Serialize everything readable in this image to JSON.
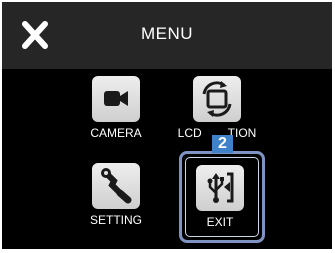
{
  "header": {
    "title": "MENU",
    "close_icon": "close-icon"
  },
  "menu": {
    "camera_label": "CAMERA",
    "lcd_label_left": "LCD",
    "lcd_label_right": "TION",
    "setting_label": "SETTING",
    "exit_label": "EXIT"
  },
  "callout": {
    "number": "2"
  },
  "colors": {
    "header_bg": "#262626",
    "screen_bg": "#000000",
    "tile_bg": "#e2e2e2",
    "selection": "#7f93c3",
    "callout_bg": "#3f82c9"
  }
}
